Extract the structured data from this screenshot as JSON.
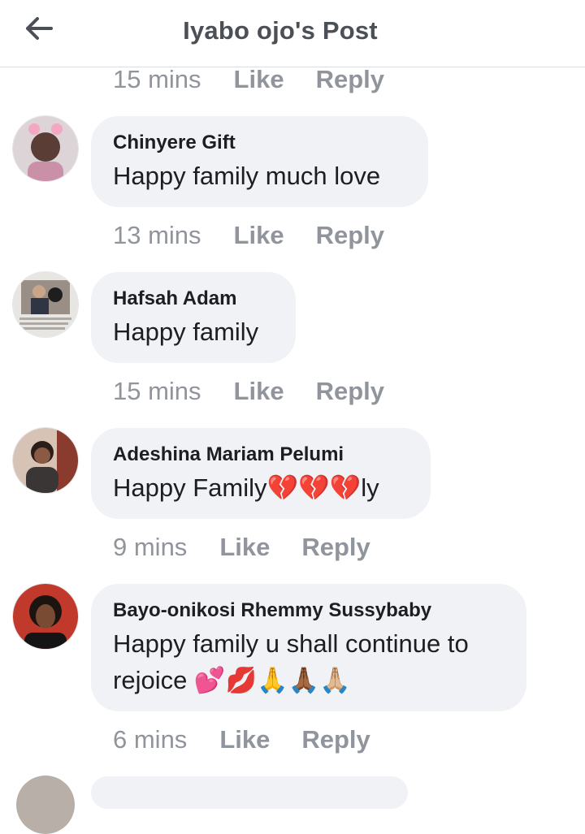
{
  "header": {
    "title": "Iyabo ojo's Post",
    "back_icon": "arrow-left-icon"
  },
  "top_actions": {
    "time": "15 mins",
    "like": "Like",
    "reply": "Reply"
  },
  "comments": [
    {
      "name": "Chinyere Gift",
      "text": "Happy family much love",
      "time": "13 mins",
      "like": "Like",
      "reply": "Reply"
    },
    {
      "name": "Hafsah Adam",
      "text": "Happy family",
      "time": "15 mins",
      "like": "Like",
      "reply": "Reply"
    },
    {
      "name": "Adeshina Mariam Pelumi",
      "text": "Happy Family💔💔💔ly",
      "time": "9 mins",
      "like": "Like",
      "reply": "Reply"
    },
    {
      "name": "Bayo-onikosi Rhemmy Sussybaby",
      "text": "Happy family u shall continue to rejoice 💕💋🙏🙏🏾🙏🏼",
      "time": "6 mins",
      "like": "Like",
      "reply": "Reply"
    }
  ],
  "colors": {
    "meta_text": "#90949c",
    "title_text": "#4b4f56",
    "bubble_bg": "#f0f2f5",
    "divider": "#dadde1"
  }
}
